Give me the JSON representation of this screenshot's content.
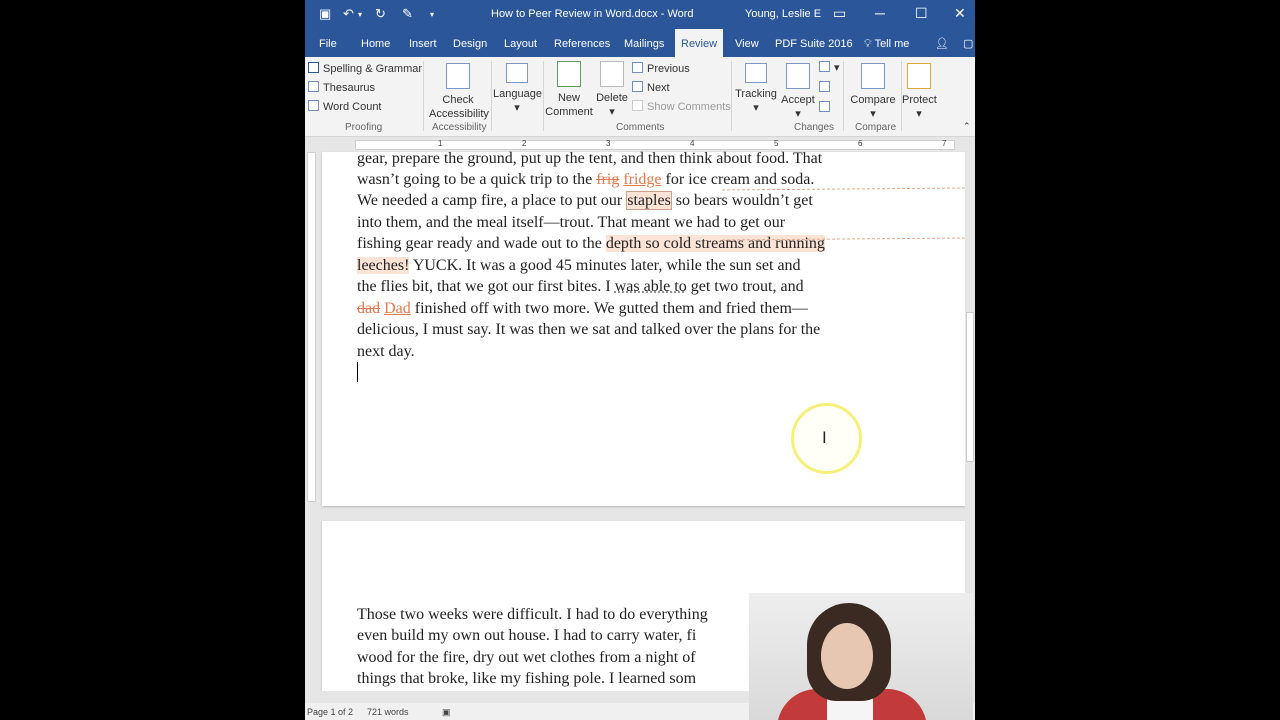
{
  "titlebar": {
    "doc_title": "How to Peer Review in Word.docx  -  Word",
    "user": "Young, Leslie E"
  },
  "tabs": [
    "File",
    "Home",
    "Insert",
    "Design",
    "Layout",
    "References",
    "Mailings",
    "Review",
    "View",
    "PDF Suite 2016",
    "Tell me"
  ],
  "active_tab": "Review",
  "ribbon": {
    "proofing": {
      "spelling": "Spelling & Grammar",
      "thesaurus": "Thesaurus",
      "wordcount": "Word Count",
      "label": "Proofing"
    },
    "accessibility": {
      "check1": "Check",
      "check2": "Accessibility",
      "label": "Accessibility"
    },
    "language": {
      "label_btn": "Language"
    },
    "comments": {
      "new1": "New",
      "new2": "Comment",
      "delete": "Delete",
      "previous": "Previous",
      "next": "Next",
      "show": "Show Comments",
      "label": "Comments"
    },
    "tracking": {
      "label_btn": "Tracking"
    },
    "changes": {
      "accept": "Accept",
      "label": "Changes"
    },
    "compare": {
      "btn": "Compare",
      "label": "Compare"
    },
    "protect": {
      "btn": "Protect"
    }
  },
  "ruler": [
    "1",
    "2",
    "3",
    "4",
    "5",
    "6",
    "7"
  ],
  "doc": {
    "l1": "gear, prepare the ground, put up the tent, and then think about food. That",
    "l2a": "wasn’t going to be a quick trip to the ",
    "l2del": "frig",
    "l2ins": "fridge",
    "l2b": " for ice cream and soda.",
    "l3a": "We needed a camp fire, a place to put our ",
    "l3hl": "staples",
    "l3b": " so bears wouldn’t get",
    "l4": "into them, and the meal itself—trout. That meant we had to get our",
    "l5a": "fishing gear ready and wade out to the ",
    "l5hl": "depth so cold streams and running",
    "l6hl": "leeches!",
    "l6b": " YUCK. It was a good 45 minutes later, while the sun set and",
    "l7a": "the flies bit, that we got our first bites. I ",
    "l7dot": "was able to",
    "l7b": " get two trout, and",
    "l8del": "dad",
    "l8ins": "Dad",
    "l8b": " finished off with two more. We gutted them and fried them—",
    "l9": "delicious, I must say. It was then we sat and talked over the plans for the",
    "l10": "next day.",
    "p2l1": "Those two weeks were difficult. I had to do everything",
    "p2l2": "even build my own out house. I had to carry water, fi",
    "p2l3": "wood for the fire, dry out wet clothes from a night of",
    "p2l4": "things that broke, like my fishing pole. I learned som"
  },
  "status": {
    "page": "Page 1 of 2",
    "words": "721 words"
  },
  "colors": {
    "title_blue": "#2b579a",
    "revision": "#e07a4f",
    "highlight": "#fbe3d6"
  }
}
